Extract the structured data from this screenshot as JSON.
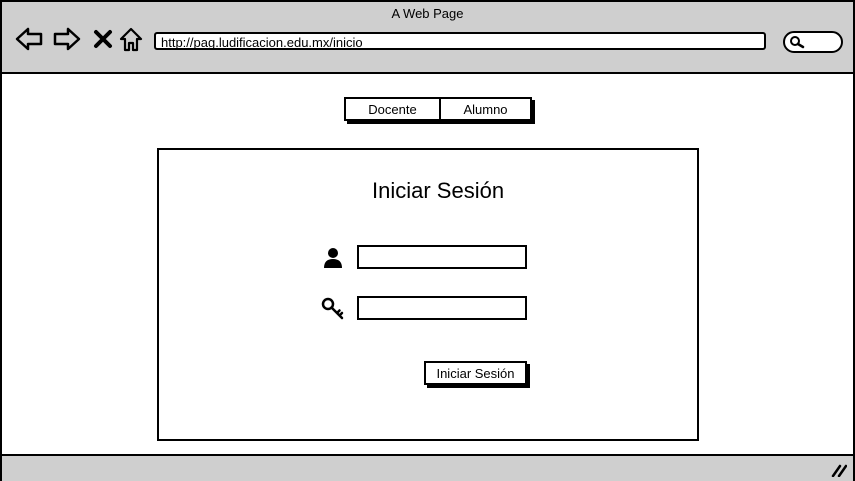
{
  "browser": {
    "window_title": "A Web Page",
    "url": "http://pag.ludificacion.edu.mx/inicio",
    "nav_icons": [
      "back-arrow-icon",
      "forward-arrow-icon",
      "close-x-icon",
      "home-icon"
    ],
    "search_icon": "search-icon"
  },
  "tabs": [
    {
      "label": "Docente"
    },
    {
      "label": "Alumno"
    }
  ],
  "login": {
    "title": "Iniciar Sesión",
    "username_icon": "user-icon",
    "password_icon": "key-icon",
    "username_value": "",
    "password_value": "",
    "submit_label": "Iniciar Sesión"
  },
  "colors": {
    "chrome": "#cfcfcf",
    "border": "#000000",
    "background": "#ffffff"
  }
}
